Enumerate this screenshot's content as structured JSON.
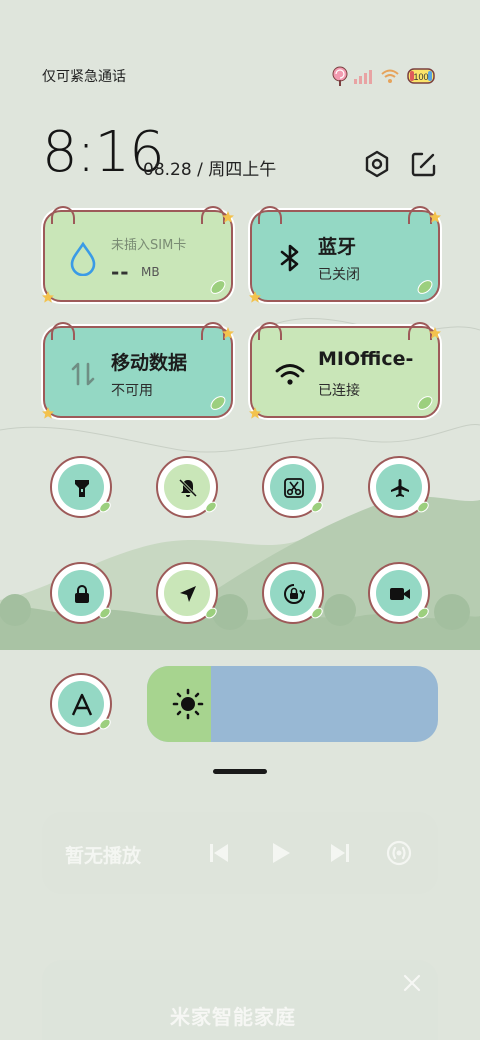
{
  "status_bar": {
    "carrier_text": "仅可紧急通话",
    "battery_level": "100",
    "icons": [
      "lollipop-icon",
      "signal-icon",
      "wifi-icon",
      "battery-icon"
    ]
  },
  "header": {
    "time": "8:16",
    "date": "08.28 / 周四上午",
    "icons": [
      "settings-icon",
      "edit-icon"
    ]
  },
  "tiles": {
    "sim": {
      "title": "未插入SIM卡",
      "data_value": "--",
      "data_unit": "MB",
      "icon": "water-drop-icon"
    },
    "bluetooth": {
      "title": "蓝牙",
      "status": "已关闭",
      "icon": "bluetooth-icon"
    },
    "mobile_data": {
      "title": "移动数据",
      "status": "不可用",
      "icon": "data-arrows-icon"
    },
    "wifi": {
      "title": "MIOffice-",
      "status": "已连接",
      "icon": "wifi-icon"
    }
  },
  "toggles": [
    {
      "name": "flashlight",
      "icon": "flashlight-icon"
    },
    {
      "name": "mute",
      "icon": "bell-off-icon"
    },
    {
      "name": "screenshot",
      "icon": "scissors-icon"
    },
    {
      "name": "airplane",
      "icon": "airplane-icon"
    },
    {
      "name": "lock",
      "icon": "lock-icon"
    },
    {
      "name": "location",
      "icon": "location-arrow-icon"
    },
    {
      "name": "rotation-lock",
      "icon": "rotation-lock-icon"
    },
    {
      "name": "screen-record",
      "icon": "video-camera-icon"
    },
    {
      "name": "reading-mode",
      "icon": "letter-a-icon"
    }
  ],
  "brightness": {
    "level_percent": 22,
    "icon": "sun-icon"
  },
  "media": {
    "title": "暂无播放",
    "icons": [
      "previous-icon",
      "play-icon",
      "next-icon",
      "cast-icon"
    ]
  },
  "smart_home": {
    "title": "米家智能家庭",
    "icon": "close-icon"
  },
  "colors": {
    "background": "#dfe5dc",
    "tile_green": "#c9e6b8",
    "tile_teal": "#94d8c4",
    "tile_border": "#9d5a59",
    "brightness_track": "#98b8d4",
    "brightness_fill": "#a7d48f"
  }
}
